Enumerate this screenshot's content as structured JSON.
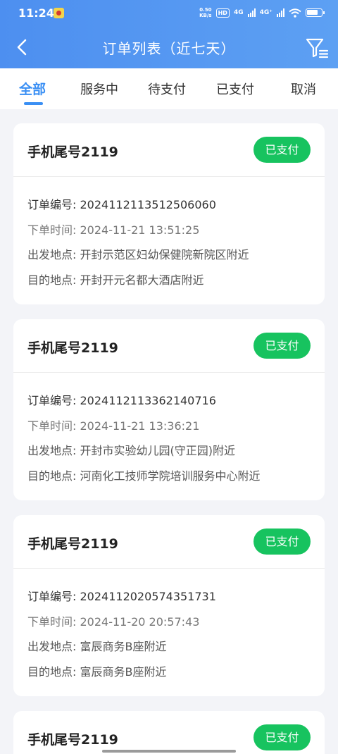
{
  "status_bar": {
    "time": "11:24",
    "net_speed_top": "0.50",
    "net_speed_bottom": "KB/s",
    "hd": "HD",
    "sim1": "4G",
    "sim2": "4G⁺"
  },
  "header": {
    "title": "订单列表（近七天）",
    "back_icon": "back-arrow-icon",
    "filter_icon": "filter-icon"
  },
  "tabs": [
    {
      "label": "全部",
      "active": true
    },
    {
      "label": "服务中",
      "active": false
    },
    {
      "label": "待支付",
      "active": false
    },
    {
      "label": "已支付",
      "active": false
    },
    {
      "label": "取消",
      "active": false
    }
  ],
  "labels": {
    "order_no": "订单编号: ",
    "order_time": "下单时间: ",
    "departure": "出发地点: ",
    "destination": "目的地点: "
  },
  "orders": [
    {
      "title": "手机尾号2119",
      "status": "已支付",
      "order_no": "2024112113512506060",
      "order_time": "2024-11-21 13:51:25",
      "departure": "开封示范区妇幼保健院新院区附近",
      "destination": "开封开元名都大酒店附近"
    },
    {
      "title": "手机尾号2119",
      "status": "已支付",
      "order_no": "2024112113362140716",
      "order_time": "2024-11-21 13:36:21",
      "departure": "开封市实验幼儿园(守正园)附近",
      "destination": "河南化工技师学院培训服务中心附近"
    },
    {
      "title": "手机尾号2119",
      "status": "已支付",
      "order_no": "2024112020574351731",
      "order_time": "2024-11-20 20:57:43",
      "departure": "富辰商务B座附近",
      "destination": "富辰商务B座附近"
    },
    {
      "title": "手机尾号2119",
      "status": "已支付"
    }
  ],
  "colors": {
    "header": "#4d8ff0",
    "accent": "#3a8ff4",
    "paid_badge": "#17c35f",
    "background": "#f3f4f8"
  }
}
